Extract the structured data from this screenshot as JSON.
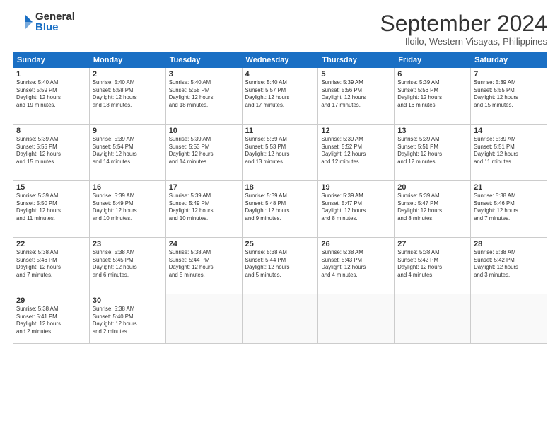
{
  "logo": {
    "general": "General",
    "blue": "Blue"
  },
  "header": {
    "month": "September 2024",
    "location": "Iloilo, Western Visayas, Philippines"
  },
  "weekdays": [
    "Sunday",
    "Monday",
    "Tuesday",
    "Wednesday",
    "Thursday",
    "Friday",
    "Saturday"
  ],
  "weeks": [
    [
      {
        "day": "1",
        "info": "Sunrise: 5:40 AM\nSunset: 5:59 PM\nDaylight: 12 hours\nand 19 minutes."
      },
      {
        "day": "2",
        "info": "Sunrise: 5:40 AM\nSunset: 5:58 PM\nDaylight: 12 hours\nand 18 minutes."
      },
      {
        "day": "3",
        "info": "Sunrise: 5:40 AM\nSunset: 5:58 PM\nDaylight: 12 hours\nand 18 minutes."
      },
      {
        "day": "4",
        "info": "Sunrise: 5:40 AM\nSunset: 5:57 PM\nDaylight: 12 hours\nand 17 minutes."
      },
      {
        "day": "5",
        "info": "Sunrise: 5:39 AM\nSunset: 5:56 PM\nDaylight: 12 hours\nand 17 minutes."
      },
      {
        "day": "6",
        "info": "Sunrise: 5:39 AM\nSunset: 5:56 PM\nDaylight: 12 hours\nand 16 minutes."
      },
      {
        "day": "7",
        "info": "Sunrise: 5:39 AM\nSunset: 5:55 PM\nDaylight: 12 hours\nand 15 minutes."
      }
    ],
    [
      {
        "day": "8",
        "info": "Sunrise: 5:39 AM\nSunset: 5:55 PM\nDaylight: 12 hours\nand 15 minutes."
      },
      {
        "day": "9",
        "info": "Sunrise: 5:39 AM\nSunset: 5:54 PM\nDaylight: 12 hours\nand 14 minutes."
      },
      {
        "day": "10",
        "info": "Sunrise: 5:39 AM\nSunset: 5:53 PM\nDaylight: 12 hours\nand 14 minutes."
      },
      {
        "day": "11",
        "info": "Sunrise: 5:39 AM\nSunset: 5:53 PM\nDaylight: 12 hours\nand 13 minutes."
      },
      {
        "day": "12",
        "info": "Sunrise: 5:39 AM\nSunset: 5:52 PM\nDaylight: 12 hours\nand 12 minutes."
      },
      {
        "day": "13",
        "info": "Sunrise: 5:39 AM\nSunset: 5:51 PM\nDaylight: 12 hours\nand 12 minutes."
      },
      {
        "day": "14",
        "info": "Sunrise: 5:39 AM\nSunset: 5:51 PM\nDaylight: 12 hours\nand 11 minutes."
      }
    ],
    [
      {
        "day": "15",
        "info": "Sunrise: 5:39 AM\nSunset: 5:50 PM\nDaylight: 12 hours\nand 11 minutes."
      },
      {
        "day": "16",
        "info": "Sunrise: 5:39 AM\nSunset: 5:49 PM\nDaylight: 12 hours\nand 10 minutes."
      },
      {
        "day": "17",
        "info": "Sunrise: 5:39 AM\nSunset: 5:49 PM\nDaylight: 12 hours\nand 10 minutes."
      },
      {
        "day": "18",
        "info": "Sunrise: 5:39 AM\nSunset: 5:48 PM\nDaylight: 12 hours\nand 9 minutes."
      },
      {
        "day": "19",
        "info": "Sunrise: 5:39 AM\nSunset: 5:47 PM\nDaylight: 12 hours\nand 8 minutes."
      },
      {
        "day": "20",
        "info": "Sunrise: 5:39 AM\nSunset: 5:47 PM\nDaylight: 12 hours\nand 8 minutes."
      },
      {
        "day": "21",
        "info": "Sunrise: 5:38 AM\nSunset: 5:46 PM\nDaylight: 12 hours\nand 7 minutes."
      }
    ],
    [
      {
        "day": "22",
        "info": "Sunrise: 5:38 AM\nSunset: 5:46 PM\nDaylight: 12 hours\nand 7 minutes."
      },
      {
        "day": "23",
        "info": "Sunrise: 5:38 AM\nSunset: 5:45 PM\nDaylight: 12 hours\nand 6 minutes."
      },
      {
        "day": "24",
        "info": "Sunrise: 5:38 AM\nSunset: 5:44 PM\nDaylight: 12 hours\nand 5 minutes."
      },
      {
        "day": "25",
        "info": "Sunrise: 5:38 AM\nSunset: 5:44 PM\nDaylight: 12 hours\nand 5 minutes."
      },
      {
        "day": "26",
        "info": "Sunrise: 5:38 AM\nSunset: 5:43 PM\nDaylight: 12 hours\nand 4 minutes."
      },
      {
        "day": "27",
        "info": "Sunrise: 5:38 AM\nSunset: 5:42 PM\nDaylight: 12 hours\nand 4 minutes."
      },
      {
        "day": "28",
        "info": "Sunrise: 5:38 AM\nSunset: 5:42 PM\nDaylight: 12 hours\nand 3 minutes."
      }
    ],
    [
      {
        "day": "29",
        "info": "Sunrise: 5:38 AM\nSunset: 5:41 PM\nDaylight: 12 hours\nand 2 minutes."
      },
      {
        "day": "30",
        "info": "Sunrise: 5:38 AM\nSunset: 5:40 PM\nDaylight: 12 hours\nand 2 minutes."
      },
      {
        "day": "",
        "info": ""
      },
      {
        "day": "",
        "info": ""
      },
      {
        "day": "",
        "info": ""
      },
      {
        "day": "",
        "info": ""
      },
      {
        "day": "",
        "info": ""
      }
    ]
  ]
}
